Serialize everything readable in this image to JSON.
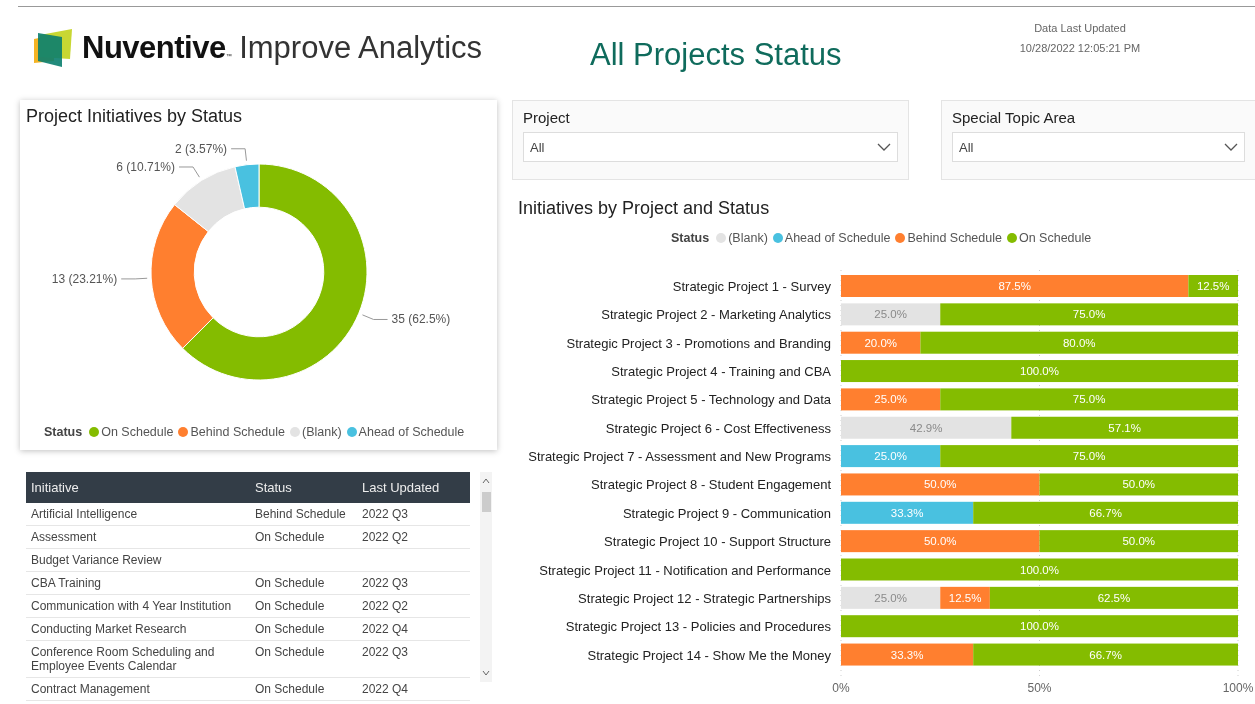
{
  "header": {
    "brand": "Nuventive",
    "brand_mark": "™",
    "product": "Improve Analytics",
    "title": "All Projects Status",
    "updated_label": "Data Last Updated",
    "updated_value": "10/28/2022 12:05:21 PM"
  },
  "donut_panel": {
    "title": "Project Initiatives by Status",
    "chart_data": {
      "type": "donut",
      "values": [
        62.5,
        23.21,
        10.71,
        3.57
      ],
      "value_labels": [
        "35 (62.5%)",
        "13 (23.21%)",
        "6 (10.71%)",
        "2 (3.57%)"
      ]
    },
    "legend": {
      "title": "Status",
      "items": [
        {
          "label": "On Schedule",
          "color": "#84bc00"
        },
        {
          "label": "Behind Schedule",
          "color": "#ff7f2f"
        },
        {
          "label": "(Blank)",
          "color": "#e3e3e3"
        },
        {
          "label": "Ahead of Schedule",
          "color": "#49c1e0"
        }
      ]
    }
  },
  "filters": [
    {
      "label": "Project",
      "value": "All"
    },
    {
      "label": "Special Topic Area",
      "value": "All"
    }
  ],
  "table": {
    "columns": [
      "Initiative",
      "Status",
      "Last Updated"
    ],
    "rows": [
      {
        "initiative": "Artificial Intelligence",
        "status": "Behind Schedule",
        "updated": "2022 Q3"
      },
      {
        "initiative": "Assessment",
        "status": "On Schedule",
        "updated": "2022 Q2"
      },
      {
        "initiative": "Budget Variance Review"
      },
      {
        "initiative": "CBA Training",
        "status": "On Schedule",
        "updated": "2022 Q3"
      },
      {
        "initiative": "Communication with 4 Year Institution",
        "status": "On Schedule",
        "updated": "2022 Q2"
      },
      {
        "initiative": "Conducting Market Research",
        "status": "On Schedule",
        "updated": "2022 Q4"
      },
      {
        "initiative": "Conference Room Scheduling and Employee Events Calendar",
        "status": "On Schedule",
        "updated": "2022 Q3"
      },
      {
        "initiative": "Contract Management",
        "status": "On Schedule",
        "updated": "2022 Q4"
      }
    ]
  },
  "bar_panel": {
    "title": "Initiatives by Project and Status",
    "legend_title": "Status",
    "chart_data": {
      "type": "bar",
      "orientation": "horizontal",
      "stacked": true,
      "categories": [
        "Strategic Project 1 - Survey",
        "Strategic Project 2 - Marketing Analytics",
        "Strategic Project 3 - Promotions and Branding",
        "Strategic Project 4 - Training and CBA",
        "Strategic Project 5 - Technology and Data",
        "Strategic Project 6 - Cost Effectiveness",
        "Strategic Project 7 - Assessment and New Programs",
        "Strategic Project 8 - Student Engagement",
        "Strategic Project 9 - Communication",
        "Strategic Project 10 - Support Structure",
        "Strategic Project 11 - Notification and Performance",
        "Strategic Project 12 - Strategic Partnerships",
        "Strategic Project 13 - Policies and Procedures",
        "Strategic Project 14 - Show Me the Money"
      ],
      "series": [
        {
          "name": "(Blank)",
          "color": "#e3e3e3",
          "values": [
            null,
            25,
            null,
            null,
            null,
            42.9,
            null,
            null,
            null,
            null,
            null,
            25,
            null,
            null
          ]
        },
        {
          "name": "Ahead of Schedule",
          "color": "#49c1e0",
          "values": [
            null,
            null,
            null,
            null,
            null,
            null,
            25,
            null,
            33.3,
            null,
            null,
            null,
            null,
            null
          ]
        },
        {
          "name": "Behind Schedule",
          "color": "#ff7f2f",
          "values": [
            87.5,
            null,
            20,
            null,
            25,
            null,
            null,
            50,
            null,
            50,
            null,
            12.5,
            null,
            33.3
          ]
        },
        {
          "name": "On Schedule",
          "color": "#84bc00",
          "values": [
            12.5,
            75,
            80,
            100,
            75,
            57.1,
            75,
            50,
            66.7,
            50,
            100,
            62.5,
            100,
            66.7
          ]
        }
      ],
      "value_labels": [
        [
          null,
          "25.0%",
          null,
          null,
          null,
          "42.9%",
          null,
          null,
          null,
          null,
          null,
          "25.0%",
          null,
          null
        ],
        [
          null,
          null,
          null,
          null,
          null,
          null,
          "25.0%",
          null,
          "33.3%",
          null,
          null,
          null,
          null,
          null
        ],
        [
          "87.5%",
          null,
          "20.0%",
          null,
          "25.0%",
          null,
          null,
          "50.0%",
          null,
          "50.0%",
          null,
          "12.5%",
          null,
          "33.3%"
        ],
        [
          "12.5%",
          "75.0%",
          "80.0%",
          "100.0%",
          "75.0%",
          "57.1%",
          "75.0%",
          "50.0%",
          "66.7%",
          "50.0%",
          "100.0%",
          "62.5%",
          "100.0%",
          "66.7%"
        ]
      ],
      "xlim": [
        0,
        100
      ],
      "xticks": [
        {
          "value": 0,
          "label": "0%"
        },
        {
          "value": 50,
          "label": "50%"
        },
        {
          "value": 100,
          "label": "100%"
        }
      ]
    }
  }
}
